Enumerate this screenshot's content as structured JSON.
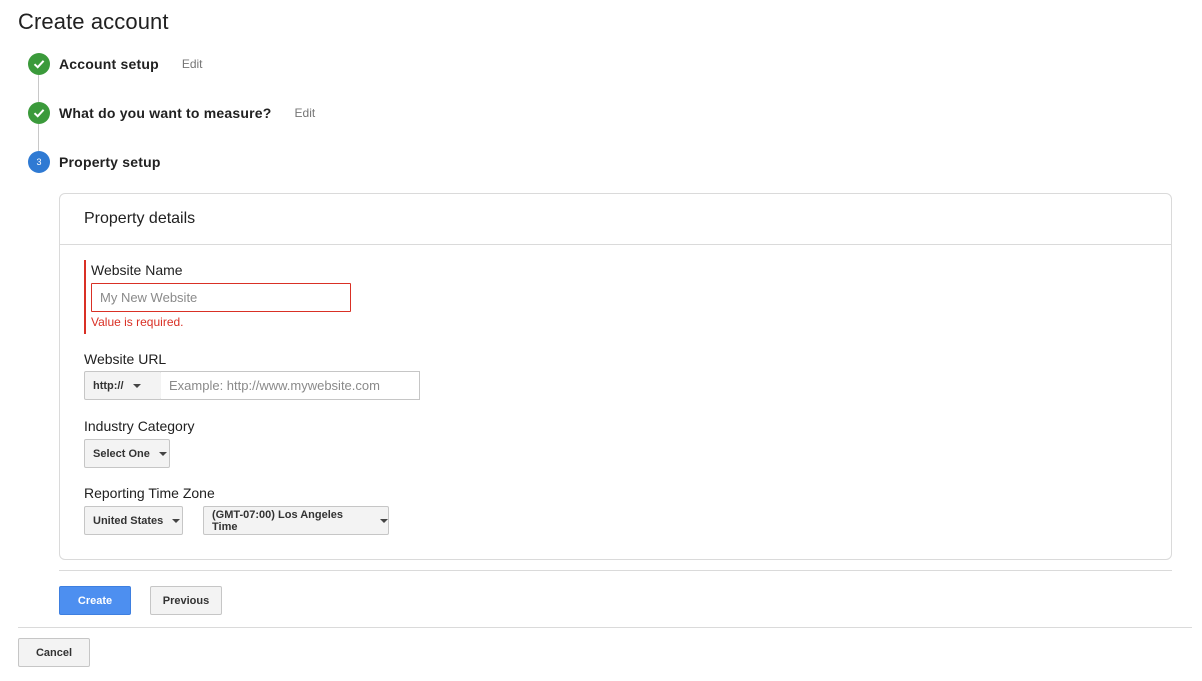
{
  "page": {
    "title": "Create account"
  },
  "steps": [
    {
      "number": "1",
      "label": "Account setup",
      "edit_label": "Edit",
      "status": "done"
    },
    {
      "number": "2",
      "label": "What do you want to measure?",
      "edit_label": "Edit",
      "status": "done"
    },
    {
      "number": "3",
      "label": "Property setup",
      "status": "active"
    }
  ],
  "card": {
    "title": "Property details",
    "website_name": {
      "label": "Website Name",
      "value": "",
      "placeholder": "My New Website",
      "error": "Value is required."
    },
    "website_url": {
      "label": "Website URL",
      "protocol": "http://",
      "value": "",
      "placeholder": "Example: http://www.mywebsite.com"
    },
    "industry": {
      "label": "Industry Category",
      "selected": "Select One"
    },
    "timezone": {
      "label": "Reporting Time Zone",
      "country": "United States",
      "zone": "(GMT-07:00) Los Angeles Time"
    }
  },
  "actions": {
    "create": "Create",
    "previous": "Previous",
    "cancel": "Cancel"
  },
  "colors": {
    "accent": "#4d8ff0",
    "success": "#3b9a3b",
    "active_step": "#2f7ad3",
    "error": "#d93025"
  }
}
